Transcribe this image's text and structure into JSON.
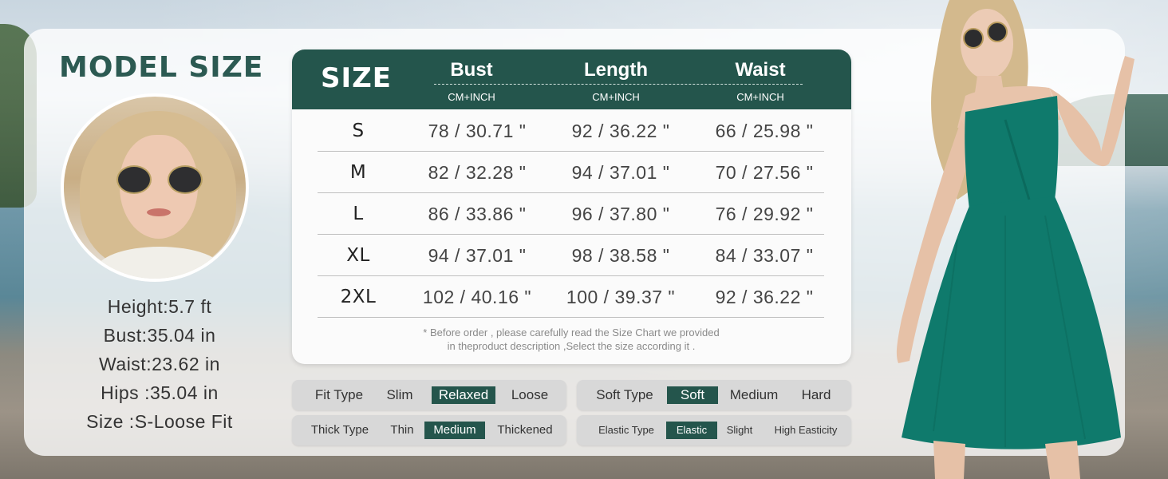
{
  "model": {
    "title": "MODEL SIZE",
    "stats": [
      "Height:5.7 ft",
      "Bust:35.04 in",
      "Waist:23.62 in",
      "Hips :35.04 in",
      "Size :S-Loose Fit"
    ]
  },
  "size_chart": {
    "size_label": "SIZE",
    "columns": [
      {
        "name": "Bust",
        "unit": "CM+INCH"
      },
      {
        "name": "Length",
        "unit": "CM+INCH"
      },
      {
        "name": "Waist",
        "unit": "CM+INCH"
      }
    ],
    "rows": [
      {
        "size": "S",
        "bust": "78 / 30.71 \"",
        "length": "92 / 36.22 \"",
        "waist": "66 / 25.98 \""
      },
      {
        "size": "M",
        "bust": "82 / 32.28 \"",
        "length": "94 / 37.01 \"",
        "waist": "70 / 27.56 \""
      },
      {
        "size": "L",
        "bust": "86 / 33.86 \"",
        "length": "96 / 37.80 \"",
        "waist": "76 / 29.92 \""
      },
      {
        "size": "XL",
        "bust": "94 / 37.01 \"",
        "length": "98 / 38.58 \"",
        "waist": "84 / 33.07 \""
      },
      {
        "size": "2XL",
        "bust": "102 / 40.16 \"",
        "length": "100 / 39.37 \"",
        "waist": "92 / 36.22 \""
      }
    ],
    "note_line1": "* Before order , please carefully read the Size Chart we provided",
    "note_line2": "in theproduct description ,Select the size according it ."
  },
  "features": {
    "fit": {
      "label": "Fit Type",
      "options": [
        "Slim",
        "Relaxed",
        "Loose"
      ],
      "selected": "Relaxed"
    },
    "soft": {
      "label": "Soft Type",
      "options": [
        "Soft",
        "Medium",
        "Hard"
      ],
      "selected": "Soft"
    },
    "thick": {
      "label": "Thick Type",
      "options": [
        "Thin",
        "Medium",
        "Thickened"
      ],
      "selected": "Medium"
    },
    "elastic": {
      "label": "Elastic Type",
      "options": [
        "Elastic",
        "Slight",
        "High Easticity"
      ],
      "selected": "Elastic"
    }
  },
  "colors": {
    "accent": "#24554c",
    "title": "#2c5a52",
    "dress": "#0f7a6c"
  }
}
